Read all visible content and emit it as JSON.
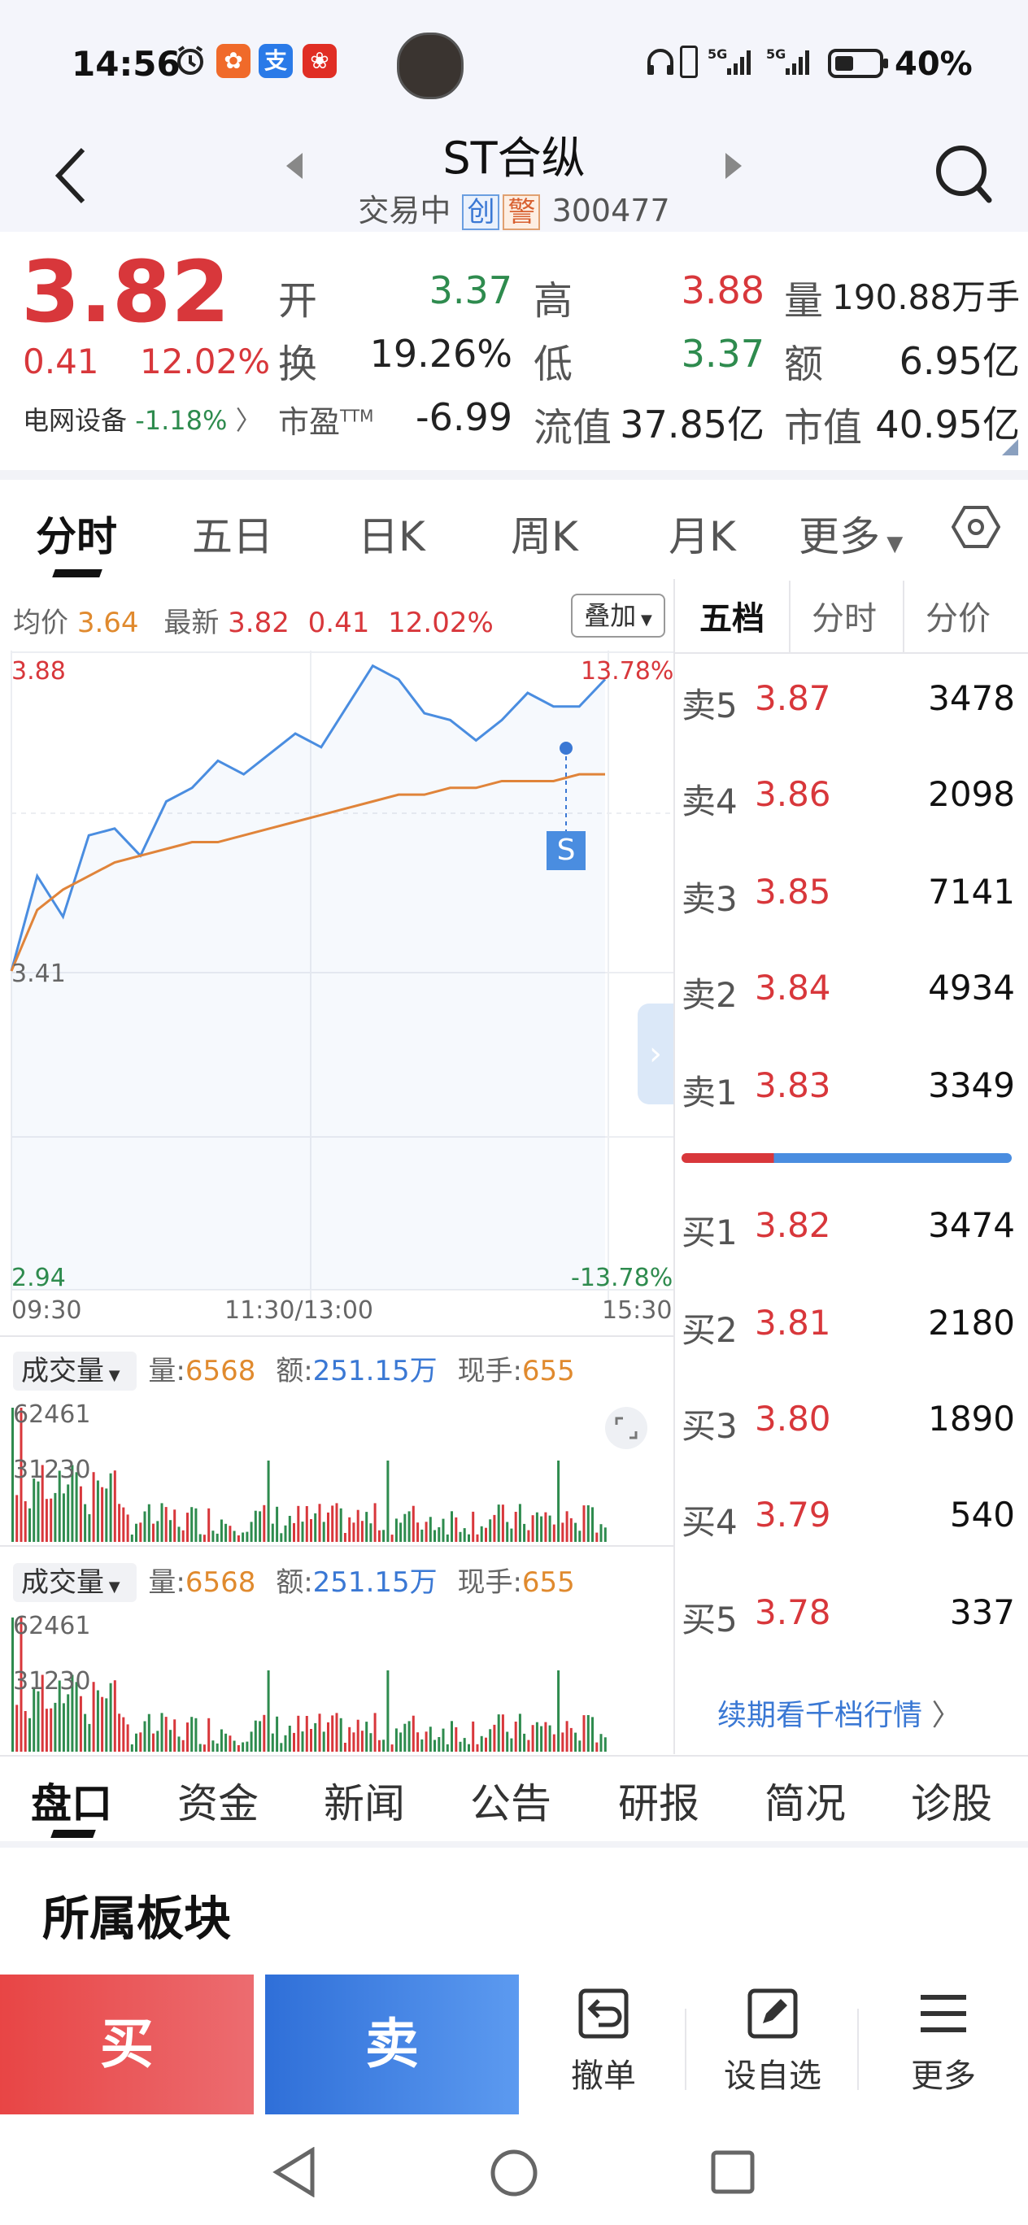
{
  "status_bar": {
    "time": "14:56",
    "battery": "40%",
    "network1": "5G",
    "network2": "5G",
    "app_icons": [
      "ant-icon",
      "alipay-icon",
      "pinduoduo-icon"
    ]
  },
  "header": {
    "name": "ST合纵",
    "status": "交易中",
    "tag1": "创",
    "tag2": "警",
    "code": "300477"
  },
  "quote": {
    "price": "3.82",
    "change": "0.41",
    "change_pct": "12.02%",
    "sector": "电网设备",
    "sector_change": "-1.18%",
    "open_label": "开",
    "open": "3.37",
    "high_label": "高",
    "high": "3.88",
    "vol_label": "量",
    "vol": "190.88万手",
    "turn_label": "换",
    "turn": "19.26%",
    "low_label": "低",
    "low": "3.37",
    "amt_label": "额",
    "amt": "6.95亿",
    "pe_label": "市盈",
    "pe_sup": "TTM",
    "pe": "-6.99",
    "float_label": "流值",
    "float_val": "37.85亿",
    "mcap_label": "市值",
    "mcap": "40.95亿"
  },
  "chart_tabs": [
    "分时",
    "五日",
    "日K",
    "周K",
    "月K",
    "更多"
  ],
  "chart_info": {
    "avg_label": "均价",
    "avg": "3.64",
    "last_label": "最新",
    "last": "3.82",
    "chg": "0.41",
    "chg_pct": "12.02%",
    "overlay": "叠加",
    "y_top": "3.88",
    "y_mid": "3.41",
    "y_bot": "2.94",
    "pct_top": "13.78%",
    "pct_bot": "-13.78%",
    "t_start": "09:30",
    "t_mid": "11:30/13:00",
    "t_end": "15:30",
    "marker": "S"
  },
  "volume_panels": [
    {
      "title": "成交量",
      "vol_label": "量:",
      "vol": "6568",
      "amt_label": "额:",
      "amt": "251.15万",
      "hand_label": "现手:",
      "hand": "655",
      "y_top": "62461",
      "y_mid": "31230"
    },
    {
      "title": "成交量",
      "vol_label": "量:",
      "vol": "6568",
      "amt_label": "额:",
      "amt": "251.15万",
      "hand_label": "现手:",
      "hand": "655",
      "y_top": "62461",
      "y_mid": "31230"
    }
  ],
  "book_tabs": [
    "五档",
    "分时",
    "分价"
  ],
  "asks": [
    {
      "label": "卖5",
      "price": "3.87",
      "vol": "3478"
    },
    {
      "label": "卖4",
      "price": "3.86",
      "vol": "2098"
    },
    {
      "label": "卖3",
      "price": "3.85",
      "vol": "7141"
    },
    {
      "label": "卖2",
      "price": "3.84",
      "vol": "4934"
    },
    {
      "label": "卖1",
      "price": "3.83",
      "vol": "3349"
    }
  ],
  "bids": [
    {
      "label": "买1",
      "price": "3.82",
      "vol": "3474"
    },
    {
      "label": "买2",
      "price": "3.81",
      "vol": "2180"
    },
    {
      "label": "买3",
      "price": "3.80",
      "vol": "1890"
    },
    {
      "label": "买4",
      "price": "3.79",
      "vol": "540"
    },
    {
      "label": "买5",
      "price": "3.78",
      "vol": "337"
    }
  ],
  "book_link": "续期看千档行情",
  "bottom_tabs": [
    "盘口",
    "资金",
    "新闻",
    "公告",
    "研报",
    "简况",
    "诊股"
  ],
  "section_title": "所属板块",
  "actions": {
    "buy": "买",
    "sell": "卖",
    "cancel": "撤单",
    "watch": "设自选",
    "more": "更多"
  },
  "colors": {
    "up": "#d8373b",
    "down": "#2e8b4e",
    "price_line": "#4a8de0",
    "avg_line": "#e0843a"
  },
  "chart_data": {
    "type": "line",
    "x": [
      "09:30",
      "11:30/13:00",
      "15:30"
    ],
    "series": [
      {
        "values": [
          3.41,
          3.55,
          3.49,
          3.61,
          3.62,
          3.58,
          3.66,
          3.68,
          3.72,
          3.7,
          3.73,
          3.76,
          3.74,
          3.8,
          3.86,
          3.84,
          3.79,
          3.78,
          3.75,
          3.78,
          3.82,
          3.8,
          3.8,
          3.84
        ]
      },
      {
        "values": [
          3.41,
          3.5,
          3.53,
          3.55,
          3.57,
          3.58,
          3.59,
          3.6,
          3.6,
          3.61,
          3.62,
          3.63,
          3.64,
          3.65,
          3.66,
          3.67,
          3.67,
          3.68,
          3.68,
          3.69,
          3.69,
          3.69,
          3.7,
          3.7
        ]
      }
    ],
    "ylim": [
      2.94,
      3.88
    ]
  }
}
